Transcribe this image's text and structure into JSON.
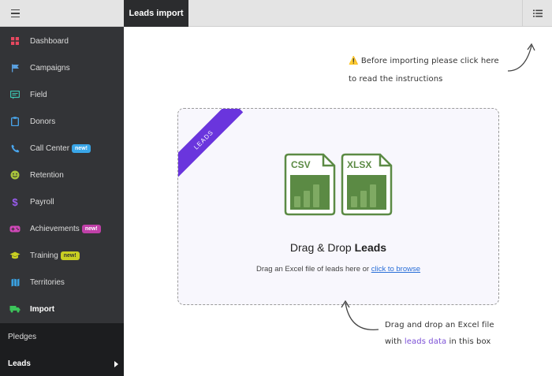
{
  "header": {
    "menu_icon": "hamburger-icon",
    "active_tab": "Leads import",
    "list_icon": "list-icon"
  },
  "sidebar": {
    "items": [
      {
        "label": "Dashboard",
        "icon": "dashboard-icon",
        "color": "#e84860"
      },
      {
        "label": "Campaigns",
        "icon": "flag-icon",
        "color": "#5aa0e0"
      },
      {
        "label": "Field",
        "icon": "message-icon",
        "color": "#3cc4b0"
      },
      {
        "label": "Donors",
        "icon": "clipboard-icon",
        "color": "#4aa8f0"
      },
      {
        "label": "Call Center",
        "icon": "phone-icon",
        "color": "#4aa8f0",
        "badge": "new!"
      },
      {
        "label": "Retention",
        "icon": "smiley-icon",
        "color": "#a8c43c"
      },
      {
        "label": "Payroll",
        "icon": "dollar-icon",
        "color": "#9b5cf0"
      },
      {
        "label": "Achievements",
        "icon": "gamepad-icon",
        "color": "#d048b8",
        "badge": "new!"
      },
      {
        "label": "Training",
        "icon": "graduation-cap-icon",
        "color": "#c9cf22",
        "badge": "new!"
      },
      {
        "label": "Territories",
        "icon": "map-icon",
        "color": "#3aa0e0"
      },
      {
        "label": "Import",
        "icon": "truck-icon",
        "color": "#3cc45a"
      }
    ],
    "subitems": [
      {
        "label": "Pledges"
      },
      {
        "label": "Leads"
      }
    ]
  },
  "hints": {
    "top_line1": "Before importing please click here",
    "top_line2": "to read the instructions",
    "bottom_line1": "Drag and drop an Excel file",
    "bottom_pre": "with",
    "bottom_highlight": "leads data",
    "bottom_post": "in this box"
  },
  "dropzone": {
    "ribbon": "LEADS",
    "file1": "CSV",
    "file2": "XLSX",
    "title_pre": "Drag & Drop",
    "title_bold": "Leads",
    "sub_pre": "Drag an Excel file of leads here or",
    "sub_link": "click to browse"
  },
  "colors": {
    "file_green": "#5b8a44",
    "ribbon": "#6a35dd",
    "sidebar": "#333437"
  }
}
